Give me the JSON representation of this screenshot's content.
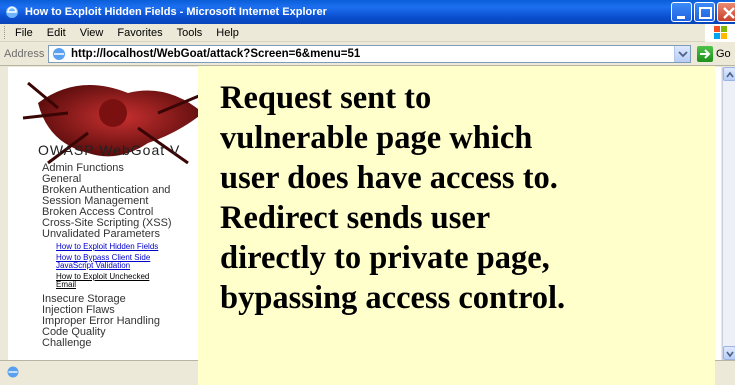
{
  "window": {
    "title": "How to Exploit Hidden Fields - Microsoft Internet Explorer"
  },
  "menu": [
    "File",
    "Edit",
    "View",
    "Favorites",
    "Tools",
    "Help"
  ],
  "address": {
    "label": "Address",
    "url": "http://localhost/WebGoat/attack?Screen=6&menu=51",
    "go_label": "Go"
  },
  "page": {
    "brand": "OWASP  WebGoat V",
    "nav": [
      "Admin Functions",
      "General",
      "Broken Authentication and",
      "Session Management",
      "Broken Access Control",
      "Cross-Site Scripting (XSS)",
      "Unvalidated Parameters"
    ],
    "subnav": [
      "How to Exploit Hidden Fields",
      "How to Bypass Client Side",
      "JavaScript Validation",
      "How to Exploit Unchecked",
      "Email"
    ],
    "nav2": [
      "Insecure Storage",
      "Injection Flaws",
      "Improper Error Handling",
      "Code Quality",
      "Challenge"
    ]
  },
  "callout": {
    "lines": [
      "Request sent to",
      "vulnerable page which",
      "user does have access to.",
      "Redirect sends user",
      "directly to private page,",
      "bypassing access control."
    ]
  },
  "colors": {
    "callout_bg": "#ffffcc",
    "titlebar": "#0a5fd8",
    "link": "#0000cc"
  }
}
